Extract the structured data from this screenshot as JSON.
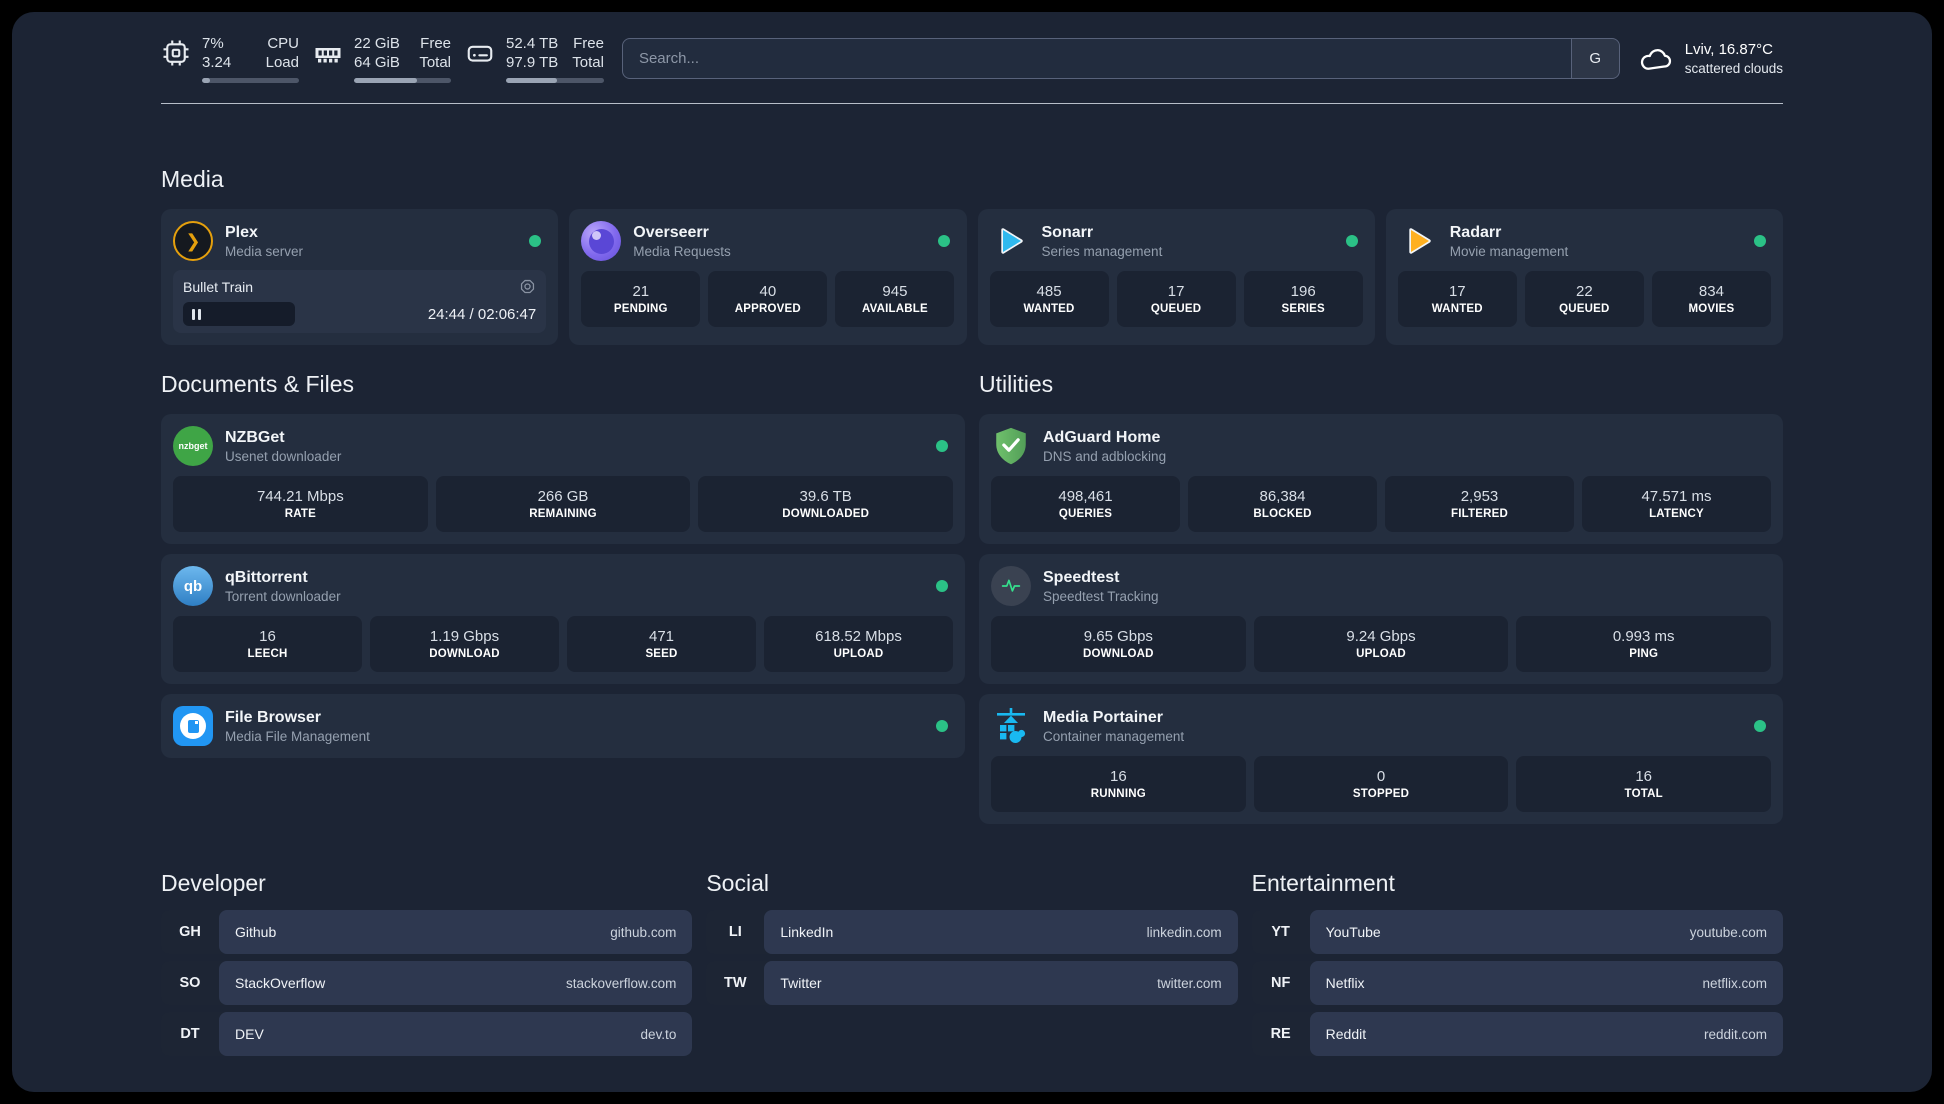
{
  "header": {
    "resources": [
      {
        "icon": "cpu-icon",
        "value_top": "7%",
        "value_bottom": "3.24",
        "label_top": "CPU",
        "label_bottom": "Load",
        "progress": 8
      },
      {
        "icon": "memory-icon",
        "value_top": "22 GiB",
        "value_bottom": "64 GiB",
        "label_top": "Free",
        "label_bottom": "Total",
        "progress": 65
      },
      {
        "icon": "disk-icon",
        "value_top": "52.4 TB",
        "value_bottom": "97.9 TB",
        "label_top": "Free",
        "label_bottom": "Total",
        "progress": 52
      }
    ],
    "search": {
      "placeholder": "Search...",
      "button_label": "G"
    },
    "weather": {
      "icon": "cloud-icon",
      "location": "Lviv, 16.87°C",
      "condition": "scattered clouds"
    }
  },
  "sections": {
    "media": {
      "title": "Media",
      "services": [
        {
          "icon": "plex-icon",
          "name": "Plex",
          "description": "Media server",
          "status": "online",
          "now_playing": {
            "title": "Bullet Train",
            "state": "paused",
            "time": "24:44 / 02:06:47"
          }
        },
        {
          "icon": "overseerr-icon",
          "name": "Overseerr",
          "description": "Media Requests",
          "status": "online",
          "stats": [
            {
              "value": "21",
              "label": "PENDING"
            },
            {
              "value": "40",
              "label": "APPROVED"
            },
            {
              "value": "945",
              "label": "AVAILABLE"
            }
          ]
        },
        {
          "icon": "sonarr-icon",
          "name": "Sonarr",
          "description": "Series management",
          "status": "online",
          "stats": [
            {
              "value": "485",
              "label": "WANTED"
            },
            {
              "value": "17",
              "label": "QUEUED"
            },
            {
              "value": "196",
              "label": "SERIES"
            }
          ]
        },
        {
          "icon": "radarr-icon",
          "name": "Radarr",
          "description": "Movie management",
          "status": "online",
          "stats": [
            {
              "value": "17",
              "label": "WANTED"
            },
            {
              "value": "22",
              "label": "QUEUED"
            },
            {
              "value": "834",
              "label": "MOVIES"
            }
          ]
        }
      ]
    },
    "documents": {
      "title": "Documents & Files",
      "services": [
        {
          "icon": "nzbget-icon",
          "name": "NZBGet",
          "description": "Usenet downloader",
          "status": "online",
          "stats": [
            {
              "value": "744.21 Mbps",
              "label": "RATE"
            },
            {
              "value": "266 GB",
              "label": "REMAINING"
            },
            {
              "value": "39.6 TB",
              "label": "DOWNLOADED"
            }
          ]
        },
        {
          "icon": "qbittorrent-icon",
          "name": "qBittorrent",
          "description": "Torrent downloader",
          "status": "online",
          "stats": [
            {
              "value": "16",
              "label": "LEECH"
            },
            {
              "value": "1.19 Gbps",
              "label": "DOWNLOAD"
            },
            {
              "value": "471",
              "label": "SEED"
            },
            {
              "value": "618.52 Mbps",
              "label": "UPLOAD"
            }
          ]
        },
        {
          "icon": "filebrowser-icon",
          "name": "File Browser",
          "description": "Media File Management",
          "status": "online",
          "stats": []
        }
      ]
    },
    "utilities": {
      "title": "Utilities",
      "services": [
        {
          "icon": "adguard-icon",
          "name": "AdGuard Home",
          "description": "DNS and adblocking",
          "stats": [
            {
              "value": "498,461",
              "label": "QUERIES"
            },
            {
              "value": "86,384",
              "label": "BLOCKED"
            },
            {
              "value": "2,953",
              "label": "FILTERED"
            },
            {
              "value": "47.571 ms",
              "label": "LATENCY"
            }
          ]
        },
        {
          "icon": "speedtest-icon",
          "name": "Speedtest",
          "description": "Speedtest Tracking",
          "stats": [
            {
              "value": "9.65 Gbps",
              "label": "DOWNLOAD"
            },
            {
              "value": "9.24 Gbps",
              "label": "UPLOAD"
            },
            {
              "value": "0.993 ms",
              "label": "PING"
            }
          ]
        },
        {
          "icon": "portainer-icon",
          "name": "Media Portainer",
          "description": "Container management",
          "status": "online",
          "stats": [
            {
              "value": "16",
              "label": "RUNNING"
            },
            {
              "value": "0",
              "label": "STOPPED"
            },
            {
              "value": "16",
              "label": "TOTAL"
            }
          ]
        }
      ]
    },
    "bookmarks": [
      {
        "title": "Developer",
        "links": [
          {
            "abbr": "GH",
            "name": "Github",
            "url": "github.com"
          },
          {
            "abbr": "SO",
            "name": "StackOverflow",
            "url": "stackoverflow.com"
          },
          {
            "abbr": "DT",
            "name": "DEV",
            "url": "dev.to"
          }
        ]
      },
      {
        "title": "Social",
        "links": [
          {
            "abbr": "LI",
            "name": "LinkedIn",
            "url": "linkedin.com"
          },
          {
            "abbr": "TW",
            "name": "Twitter",
            "url": "twitter.com"
          }
        ]
      },
      {
        "title": "Entertainment",
        "links": [
          {
            "abbr": "YT",
            "name": "YouTube",
            "url": "youtube.com"
          },
          {
            "abbr": "NF",
            "name": "Netflix",
            "url": "netflix.com"
          },
          {
            "abbr": "RE",
            "name": "Reddit",
            "url": "reddit.com"
          }
        ]
      }
    ]
  },
  "colors": {
    "status_online": "#2bc186",
    "background": "#1c2434",
    "card": "#242e3f",
    "plex_accent": "#e5a00d"
  },
  "nzbget_icon_text": "nzbget",
  "qbittorrent_icon_text": "qb"
}
